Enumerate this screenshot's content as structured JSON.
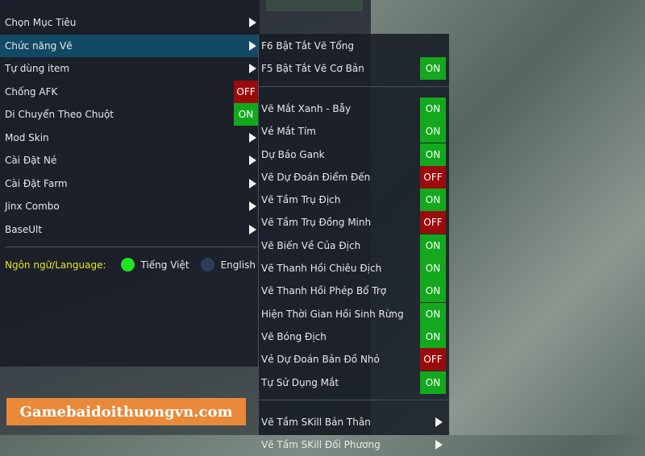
{
  "colors": {
    "on": "#14a81e",
    "off": "#9c0b0b",
    "highlight": "#124a66",
    "language_label": "#e6e62a"
  },
  "main_menu": [
    {
      "label": "Chọn Mục Tiêu",
      "type": "submenu"
    },
    {
      "label": "Chức năng Vẽ",
      "type": "submenu",
      "selected": true
    },
    {
      "label": "Tự dùng item",
      "type": "submenu"
    },
    {
      "label": "Chống AFK",
      "type": "toggle",
      "state": "OFF"
    },
    {
      "label": "Di Chuyển Theo Chuột",
      "type": "toggle",
      "state": "ON"
    },
    {
      "label": "Mod Skin",
      "type": "submenu"
    },
    {
      "label": "Cài Đặt Né",
      "type": "submenu"
    },
    {
      "label": "Cài Đặt Farm",
      "type": "submenu"
    },
    {
      "label": "Jinx Combo",
      "type": "submenu"
    },
    {
      "label": "BaseUlt",
      "type": "submenu"
    }
  ],
  "language": {
    "label": "Ngôn ngữ/Language:",
    "options": [
      {
        "label": "Tiếng Việt",
        "selected": true
      },
      {
        "label": "English",
        "selected": false
      }
    ]
  },
  "submenu": [
    {
      "label": "F6 Bật Tắt Vẽ Tổng",
      "type": "plain"
    },
    {
      "label": "F5 Bật Tắt Vẽ Cơ Bản",
      "type": "toggle",
      "state": "ON"
    },
    {
      "type": "divider"
    },
    {
      "label": "Vẽ Mắt Xanh - Bẫy",
      "type": "toggle",
      "state": "ON"
    },
    {
      "label": "Vẻ Mắt Tím",
      "type": "toggle",
      "state": "ON"
    },
    {
      "label": "Dự Báo Gank",
      "type": "toggle",
      "state": "ON"
    },
    {
      "label": "Vẽ Dự Đoán Điểm Đến",
      "type": "toggle",
      "state": "OFF"
    },
    {
      "label": "Vẽ Tầm Trụ Địch",
      "type": "toggle",
      "state": "ON"
    },
    {
      "label": "Vẽ Tầm Trụ Đồng Minh",
      "type": "toggle",
      "state": "OFF"
    },
    {
      "label": "Vẽ Biến Về Của Địch",
      "type": "toggle",
      "state": "ON"
    },
    {
      "label": "Vẽ Thanh Hồi Chiêu Địch",
      "type": "toggle",
      "state": "ON"
    },
    {
      "label": "Vẽ Thanh Hồi Phép Bổ Trợ",
      "type": "toggle",
      "state": "ON"
    },
    {
      "label": "Hiện Thời Gian Hồi Sinh Rừng",
      "type": "toggle",
      "state": "ON"
    },
    {
      "label": "Vẽ Bóng Địch",
      "type": "toggle",
      "state": "ON"
    },
    {
      "label": "Vẻ Dự Đoán Bản Đồ Nhỏ",
      "type": "toggle",
      "state": "OFF"
    },
    {
      "label": "Tự Sử Dụng Mắt",
      "type": "toggle",
      "state": "ON"
    },
    {
      "type": "divider"
    },
    {
      "label": "Vẽ Tầm SKill Bản Thân",
      "type": "submenu"
    },
    {
      "label": "Vẽ Tầm SKill Đối Phương",
      "type": "submenu"
    }
  ],
  "watermark": "Gamebaidoithuongvn.com"
}
